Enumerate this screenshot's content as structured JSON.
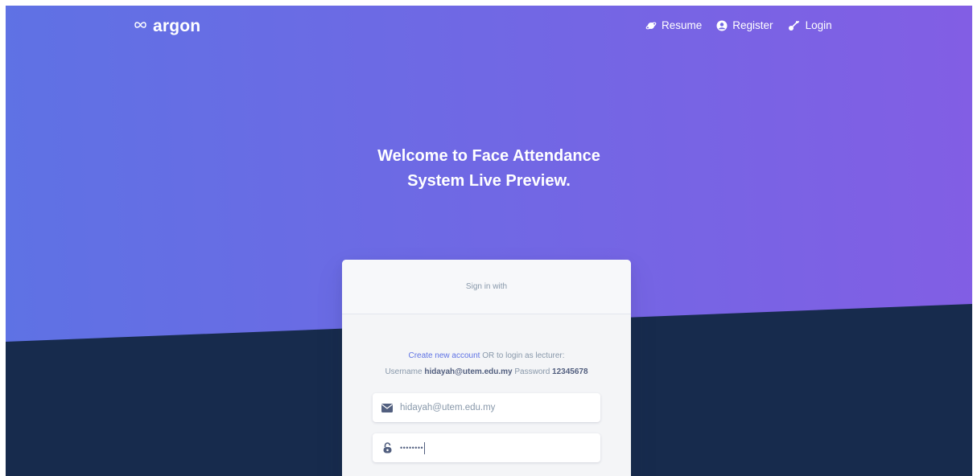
{
  "brand": {
    "name": "argon",
    "icon": "infinity-icon"
  },
  "nav": [
    {
      "label": "Resume",
      "icon": "planet-icon"
    },
    {
      "label": "Register",
      "icon": "user-circle-icon"
    },
    {
      "label": "Login",
      "icon": "key-icon"
    }
  ],
  "headline": {
    "line1": "Welcome to Face Attendance",
    "line2": "System Live Preview."
  },
  "card": {
    "header": "Sign in with",
    "create_link": "Create new account",
    "note_text": "OR to login as lecturer:",
    "username_label": "Username",
    "username_value": "hidayah@utem.edu.my",
    "password_label": "Password",
    "password_value": "12345678"
  },
  "form": {
    "email_value": "hidayah@utem.edu.my",
    "email_icon": "envelope-icon",
    "password_value": "••••••••",
    "password_icon": "lock-icon"
  },
  "colors": {
    "gradient_start": "#5e72e4",
    "gradient_end": "#825ee4",
    "background_dark": "#172b4d",
    "link": "#5e72e4"
  }
}
